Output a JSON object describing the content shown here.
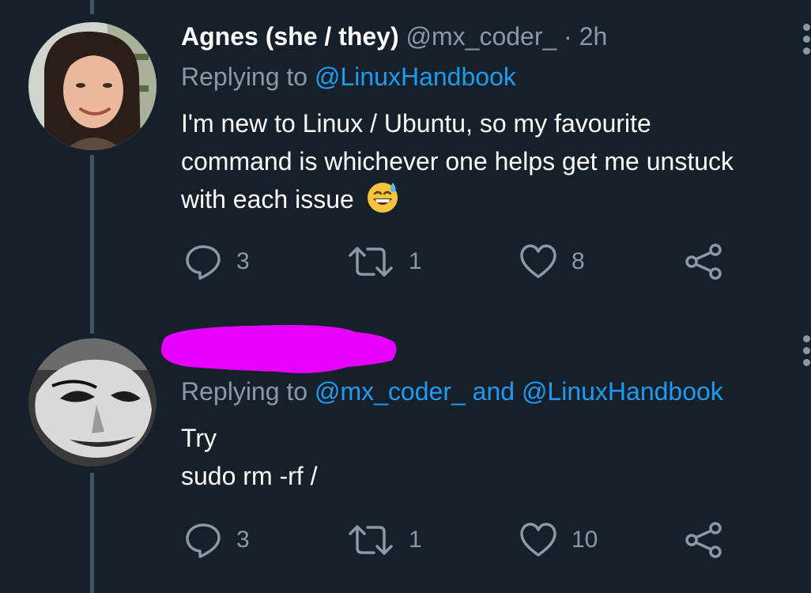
{
  "tweets": [
    {
      "author_name": "Agnes (she / they)",
      "handle": "@mx_coder_",
      "separator": "·",
      "time": "2h",
      "replying_prefix": "Replying to",
      "replying_users": "@LinuxHandbook",
      "body_lines": [
        "I'm new to Linux / Ubuntu, so my favourite",
        "command is whichever one helps get me unstuck",
        "with each issue"
      ],
      "emoji": "grinning-face-with-sweat",
      "replies": "3",
      "retweets": "1",
      "likes": "8"
    },
    {
      "author_redacted": true,
      "replying_prefix": "Replying to",
      "replying_users": "@mx_coder_ and @LinuxHandbook",
      "body_lines": [
        "Try",
        "sudo rm -rf /"
      ],
      "replies": "3",
      "retweets": "1",
      "likes": "10"
    }
  ],
  "colors": {
    "background": "#15202b",
    "text": "#ffffff",
    "muted": "#8b98a5",
    "link": "#1d9bf0",
    "thread_line": "#3d5466",
    "redaction": "#e600ff"
  },
  "icons": [
    "reply-icon",
    "retweet-icon",
    "like-icon",
    "share-icon",
    "more-options-icon"
  ]
}
